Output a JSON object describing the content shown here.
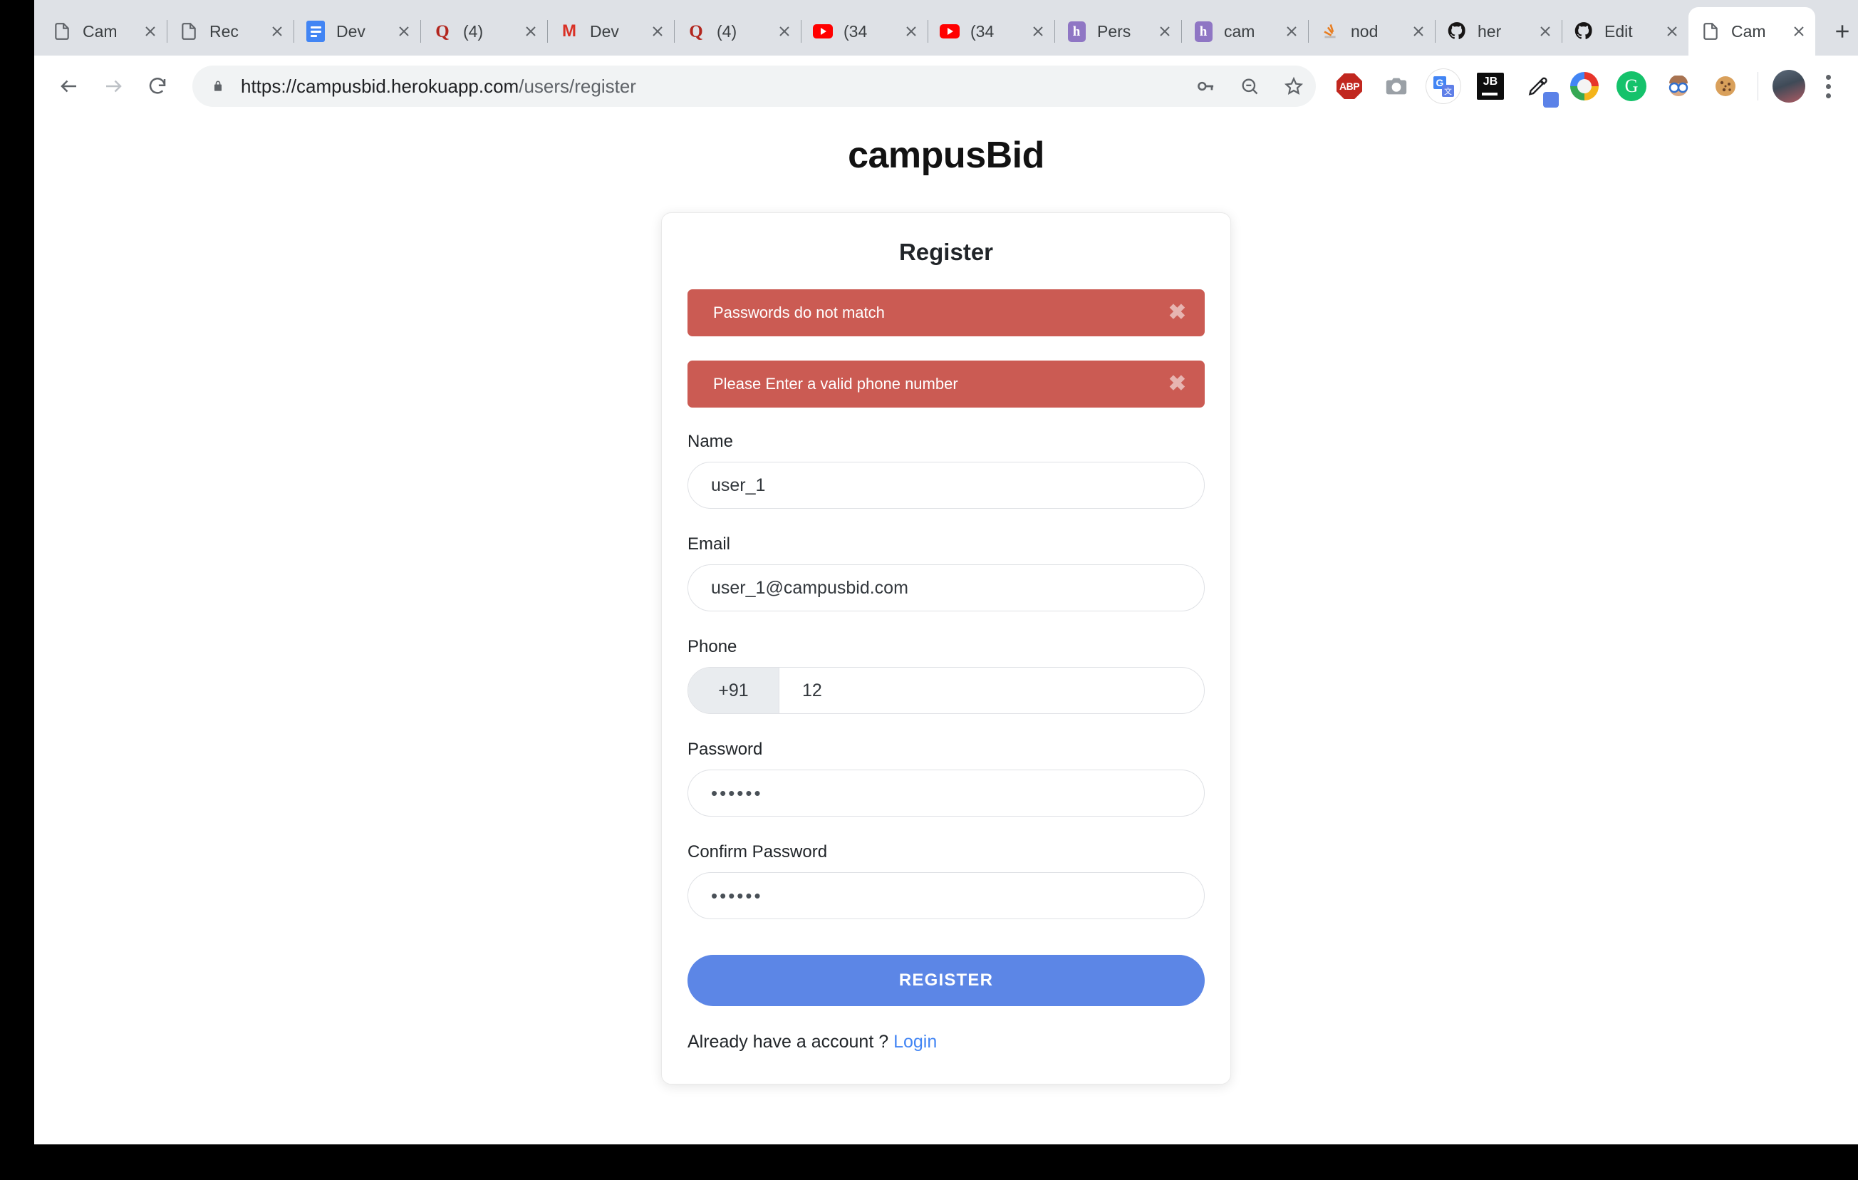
{
  "browser": {
    "tabs": [
      {
        "title": "Cam",
        "favicon": "doc-icon",
        "active": false
      },
      {
        "title": "Rec",
        "favicon": "doc-icon",
        "active": false
      },
      {
        "title": "Dev",
        "favicon": "google-docs-icon",
        "active": false
      },
      {
        "title": "(4)",
        "favicon": "quora-icon",
        "active": false
      },
      {
        "title": "Dev",
        "favicon": "gmail-icon",
        "active": false
      },
      {
        "title": "(4)",
        "favicon": "quora-icon",
        "active": false
      },
      {
        "title": "(34",
        "favicon": "youtube-icon",
        "active": false
      },
      {
        "title": "(34",
        "favicon": "youtube-icon",
        "active": false
      },
      {
        "title": "Pers",
        "favicon": "heroku-icon",
        "active": false
      },
      {
        "title": "cam",
        "favicon": "heroku-icon",
        "active": false
      },
      {
        "title": "nod",
        "favicon": "stackoverflow-icon",
        "active": false
      },
      {
        "title": "her",
        "favicon": "github-icon",
        "active": false
      },
      {
        "title": "Edit",
        "favicon": "github-icon",
        "active": false
      },
      {
        "title": "Cam",
        "favicon": "doc-icon",
        "active": true
      }
    ],
    "new_tab_label": "+",
    "url_prefix": "https://campusbid.herokuapp.com",
    "url_path": "/users/register",
    "url_full": "https://campusbid.herokuapp.com/users/register",
    "extensions": [
      {
        "name": "adblock-plus-icon",
        "label": "ABP"
      },
      {
        "name": "screenshot-camera-icon",
        "label": ""
      },
      {
        "name": "google-translate-icon",
        "label": "G"
      },
      {
        "name": "jetbrains-toolbox-icon",
        "label": "JB"
      },
      {
        "name": "color-picker-icon",
        "label": ""
      },
      {
        "name": "internet-download-manager-icon",
        "label": ""
      },
      {
        "name": "grammarly-icon",
        "label": "G"
      },
      {
        "name": "glasses-extension-icon",
        "label": ""
      },
      {
        "name": "cookie-editor-icon",
        "label": ""
      }
    ]
  },
  "page": {
    "brand": "campusBid",
    "card_title": "Register",
    "alerts": [
      {
        "message": "Passwords do not match",
        "close_label": "✖",
        "color": "#cb5b53"
      },
      {
        "message": "Please Enter a valid phone number",
        "close_label": "✖",
        "color": "#cb5b53"
      }
    ],
    "fields": {
      "name": {
        "label": "Name",
        "value": "user_1"
      },
      "email": {
        "label": "Email",
        "value": "user_1@campusbid.com"
      },
      "phone": {
        "label": "Phone",
        "prefix": "+91",
        "value": "12"
      },
      "password": {
        "label": "Password",
        "value": "••••••"
      },
      "confirm_password": {
        "label": "Confirm Password",
        "value": "••••••"
      }
    },
    "submit_label": "REGISTER",
    "footer_text": "Already have a account ?",
    "login_link": "Login",
    "accent_color": "#5c86e6",
    "link_color": "#4285f4"
  }
}
